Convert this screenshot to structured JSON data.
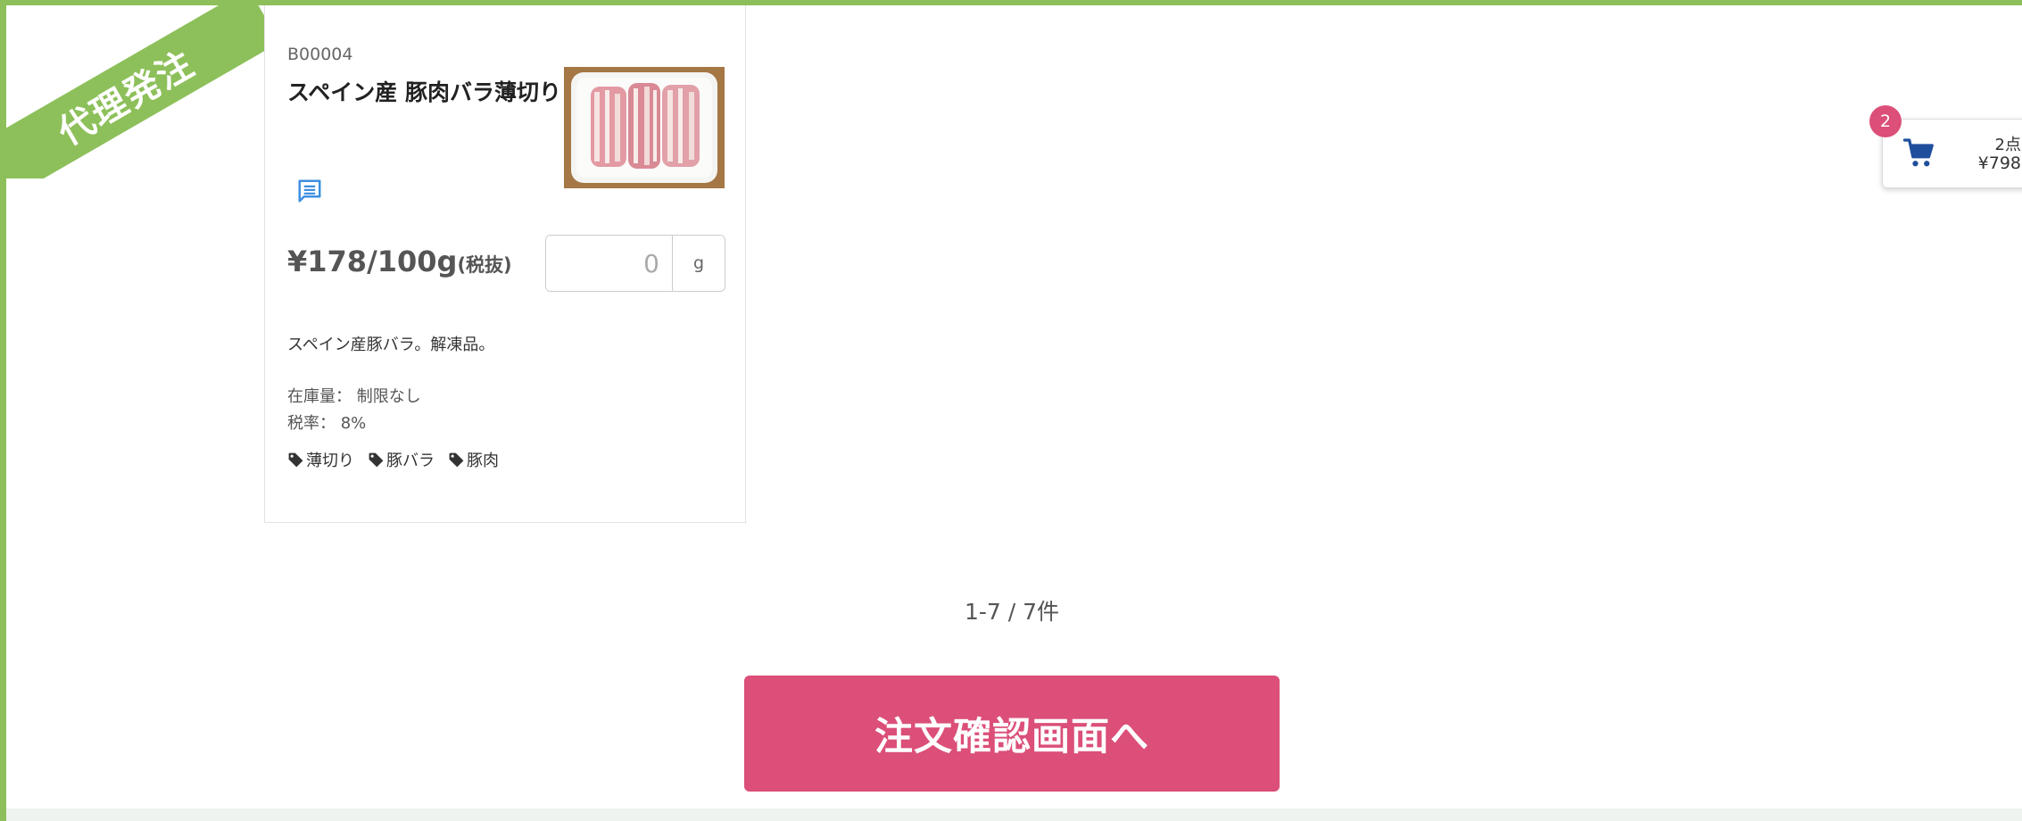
{
  "colors": {
    "accent_green": "#8dc05a",
    "accent_pink": "#db4f78",
    "cart_icon_blue": "#1f4f9c",
    "comment_icon_blue": "#3d8fe0"
  },
  "ribbon": {
    "label": "代理発注"
  },
  "product": {
    "sku": "B00004",
    "name": "スペイン産 豚肉バラ薄切り",
    "image_icon": "product-photo",
    "comment_icon": "comment-icon",
    "price_main": "¥178/100g",
    "price_tax_note": "(税抜)",
    "quantity_placeholder": "0",
    "quantity_unit": "g",
    "description": "スペイン産豚バラ。解凍品。",
    "stock_line": "在庫量： 制限なし",
    "tax_rate_line": "税率： 8%",
    "tags": [
      {
        "label": "薄切り",
        "icon": "tag-icon"
      },
      {
        "label": "豚バラ",
        "icon": "tag-icon"
      },
      {
        "label": "豚肉",
        "icon": "tag-icon"
      }
    ]
  },
  "pagination": {
    "text": "1-7 / 7件"
  },
  "confirm_button": {
    "label": "注文確認画面へ"
  },
  "cart": {
    "icon": "cart-icon",
    "badge_count": "2",
    "items_text": "2点",
    "total_text": "¥798"
  }
}
